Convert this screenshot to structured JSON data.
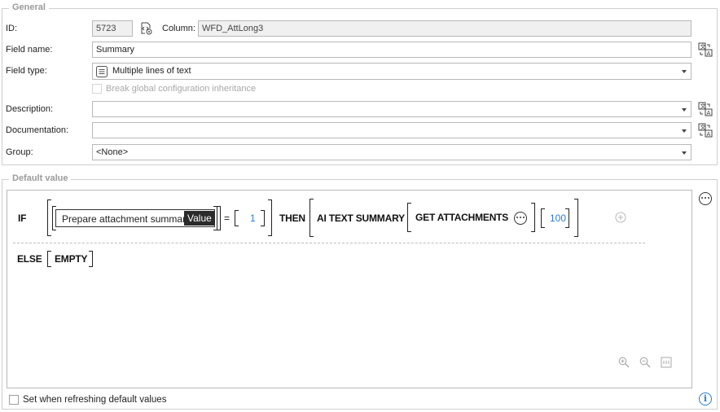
{
  "general": {
    "legend": "General",
    "id_label": "ID:",
    "id_value": "5723",
    "column_label": "Column:",
    "column_value": "WFD_AttLong3",
    "field_name_label": "Field name:",
    "field_name_value": "Summary",
    "field_type_label": "Field type:",
    "field_type_value": "Multiple lines of text",
    "inherit_label": "Break global configuration inheritance",
    "description_label": "Description:",
    "description_value": "",
    "documentation_label": "Documentation:",
    "documentation_value": "",
    "group_label": "Group:",
    "group_value": "<None>"
  },
  "default_value": {
    "legend": "Default value",
    "if_kw": "IF",
    "condition_field": "Prepare attachment summary",
    "condition_tag": "Value",
    "operator": "=",
    "condition_value": "1",
    "then_kw": "THEN",
    "function_name": "AI TEXT SUMMARY",
    "nested_function": "GET ATTACHMENTS",
    "limit_value": "100",
    "else_kw": "ELSE",
    "else_value": "EMPTY"
  },
  "footer": {
    "refresh_label": "Set when refreshing default values",
    "info_glyph": "i"
  },
  "icons": {
    "field_type_icon": "lines-icon",
    "column_icon": "code-settings-icon",
    "translate_icon": "translate-icon",
    "more_icon": "ellipsis-icon",
    "add_icon": "plus-circle-icon",
    "zoom_in_icon": "zoom-in-icon",
    "zoom_out_icon": "zoom-out-icon",
    "fit_icon": "fit-icon",
    "info_icon": "info-icon"
  },
  "colors": {
    "accent": "#2b7cd3",
    "legend": "#9a9a9a",
    "tag_bg": "#2b2b2b"
  }
}
